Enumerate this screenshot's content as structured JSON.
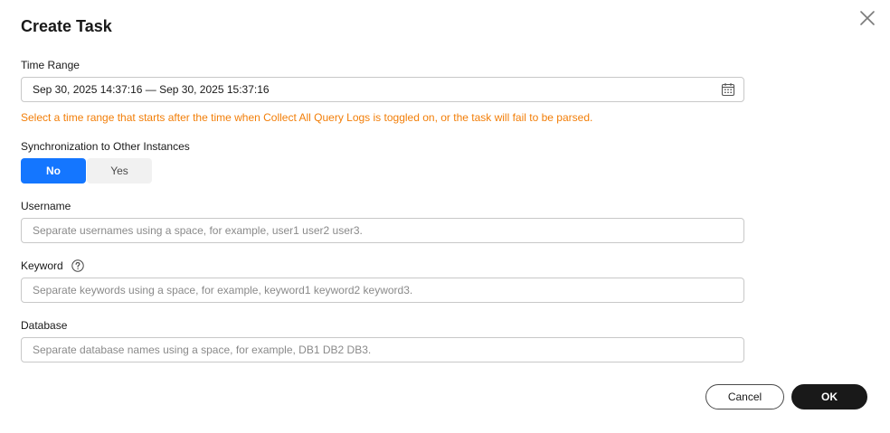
{
  "dialog": {
    "title": "Create Task",
    "close_icon": "close-icon"
  },
  "time_range": {
    "label": "Time Range",
    "value": "Sep 30, 2025 14:37:16 — Sep 30, 2025 15:37:16",
    "icon": "calendar-icon",
    "hint": "Select a time range that starts after the time when Collect All Query Logs is toggled on, or the task will fail to be parsed.",
    "hint_color": "#f27e08"
  },
  "sync": {
    "label": "Synchronization to Other Instances",
    "options": [
      "No",
      "Yes"
    ],
    "selected": "No",
    "accent_color": "#1476ff"
  },
  "username": {
    "label": "Username",
    "placeholder": "Separate usernames using a space, for example, user1 user2 user3."
  },
  "keyword": {
    "label": "Keyword",
    "help_icon": "help-icon",
    "placeholder": "Separate keywords using a space, for example, keyword1 keyword2 keyword3."
  },
  "database": {
    "label": "Database",
    "placeholder": "Separate database names using a space, for example, DB1 DB2 DB3."
  },
  "footer": {
    "cancel_label": "Cancel",
    "ok_label": "OK"
  }
}
